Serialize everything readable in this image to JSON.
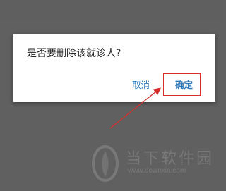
{
  "dialog": {
    "message": "是否要删除该就诊人?",
    "cancel_label": "取消",
    "confirm_label": "确定"
  },
  "watermark": {
    "title": "当下软件园",
    "url": "www.downxia.com"
  },
  "colors": {
    "overlay": "#606060",
    "dialog_bg": "#ffffff",
    "button_text": "#2a76b8",
    "highlight": "#d62d2d"
  }
}
